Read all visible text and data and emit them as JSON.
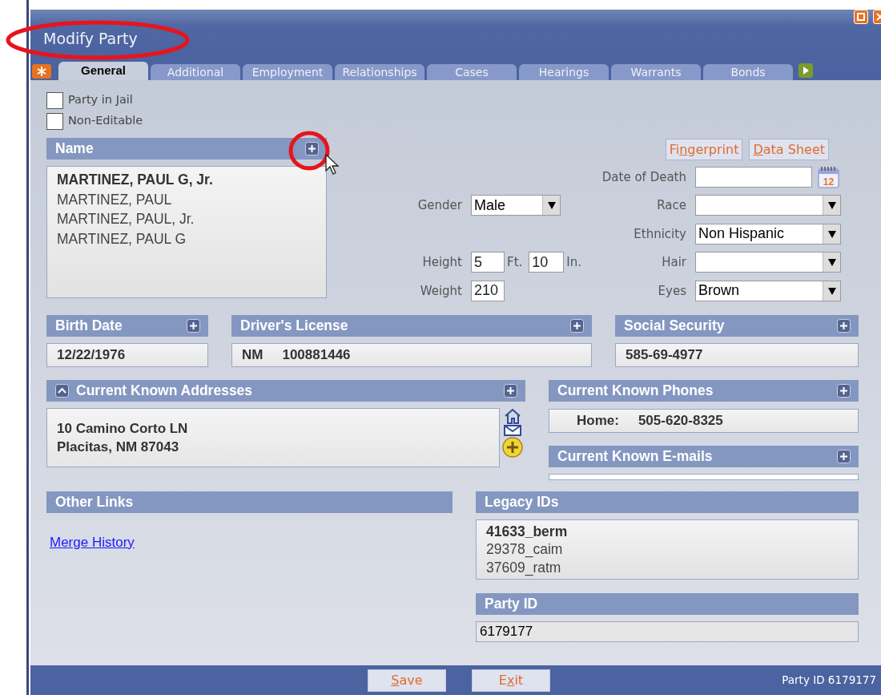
{
  "window": {
    "title": "Modify Party"
  },
  "tabs": [
    {
      "label": "General",
      "selected": true
    },
    {
      "label": "Additional",
      "selected": false
    },
    {
      "label": "Employment",
      "selected": false
    },
    {
      "label": "Relationships",
      "selected": false
    },
    {
      "label": "Cases",
      "selected": false
    },
    {
      "label": "Hearings",
      "selected": false
    },
    {
      "label": "Warrants",
      "selected": false
    },
    {
      "label": "Bonds",
      "selected": false
    }
  ],
  "checkboxes": [
    {
      "label": "Party in Jail",
      "checked": false
    },
    {
      "label": "Non-Editable",
      "checked": false
    }
  ],
  "name_panel": {
    "title": "Name",
    "names": [
      {
        "text": "MARTINEZ, PAUL G, Jr.",
        "primary": true
      },
      {
        "text": "MARTINEZ, PAUL",
        "primary": false
      },
      {
        "text": "MARTINEZ, PAUL, Jr.",
        "primary": false
      },
      {
        "text": "MARTINEZ, PAUL G",
        "primary": false
      }
    ]
  },
  "action_buttons": [
    {
      "before": "Fi",
      "key": "n",
      "after": "gerprint"
    },
    {
      "key": "D",
      "after": "ata Sheet"
    }
  ],
  "form_rows": [
    {
      "right": {
        "label": "Date of Death",
        "kind": "date",
        "icon_text": "12"
      }
    },
    {
      "left": {
        "label": "Gender",
        "kind": "select",
        "value": "Male"
      },
      "right": {
        "label": "Race",
        "kind": "select"
      }
    },
    {
      "right": {
        "label": "Ethnicity",
        "kind": "select",
        "value": "Non Hispanic"
      }
    },
    {
      "left": {
        "label": "Height",
        "kind": "measure",
        "parts": [
          {
            "value": "5",
            "unit": "Ft."
          },
          {
            "value": "10",
            "unit": "In."
          }
        ]
      },
      "right": {
        "label": "Hair",
        "kind": "select"
      }
    },
    {
      "left": {
        "label": "Weight",
        "kind": "input",
        "value": "210"
      },
      "right": {
        "label": "Eyes",
        "kind": "select",
        "value": "Brown"
      }
    }
  ],
  "birth_date": {
    "title": "Birth Date",
    "value": "12/22/1976"
  },
  "drivers_license": {
    "title": "Driver's License",
    "state": "NM",
    "number": "100881446"
  },
  "social_security": {
    "title": "Social Security",
    "value": "585-69-4977"
  },
  "addresses": {
    "title": "Current Known Addresses",
    "expanded": true,
    "lines": [
      "10 Camino Corto LN",
      "Placitas, NM 87043"
    ]
  },
  "phones": {
    "title": "Current Known Phones",
    "entries": [
      {
        "type": "Home:",
        "number": "505-620-8325"
      }
    ]
  },
  "emails": {
    "title": "Current Known E-mails"
  },
  "other_links": {
    "title": "Other Links",
    "links": [
      "Merge History"
    ]
  },
  "legacy_ids": {
    "title": "Legacy IDs",
    "ids": [
      {
        "text": "41633_berm",
        "primary": true
      },
      {
        "text": "29378_caim",
        "primary": false
      },
      {
        "text": "37609_ratm",
        "primary": false
      }
    ]
  },
  "party_id": {
    "title": "Party ID",
    "value": "6179177"
  },
  "footer": {
    "buttons": [
      {
        "key": "S",
        "after": "ave"
      },
      {
        "before": "E",
        "key": "x",
        "after": "it"
      }
    ],
    "status": "Party ID 6179177"
  }
}
